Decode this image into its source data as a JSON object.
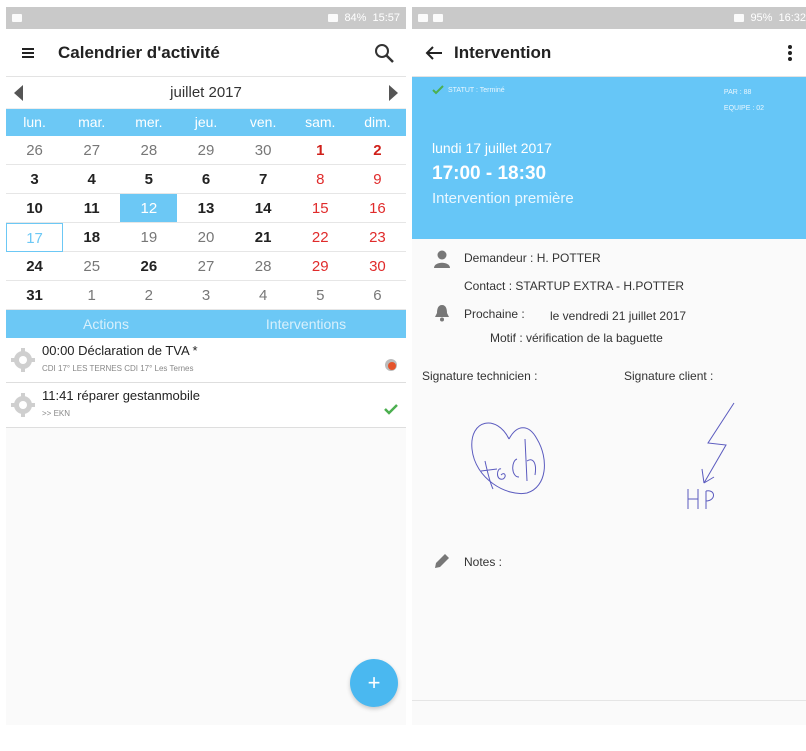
{
  "left": {
    "status": {
      "battery": "84%",
      "time": "15:57"
    },
    "appbar": {
      "title": "Calendrier d'activité"
    },
    "calendar": {
      "month": "juillet 2017",
      "weekdays": [
        "lun.",
        "mar.",
        "mer.",
        "jeu.",
        "ven.",
        "sam.",
        "dim."
      ],
      "weeks": [
        [
          {
            "t": "26",
            "s": "dim"
          },
          {
            "t": "27",
            "s": "dim"
          },
          {
            "t": "28",
            "s": "dim"
          },
          {
            "t": "29",
            "s": "dim"
          },
          {
            "t": "30",
            "s": "dim"
          },
          {
            "t": "1",
            "s": "redbold"
          },
          {
            "t": "2",
            "s": "redbold"
          }
        ],
        [
          {
            "t": "3",
            "s": "bold"
          },
          {
            "t": "4",
            "s": "bold"
          },
          {
            "t": "5",
            "s": "bold"
          },
          {
            "t": "6",
            "s": "bold"
          },
          {
            "t": "7",
            "s": "bold"
          },
          {
            "t": "8",
            "s": "red"
          },
          {
            "t": "9",
            "s": "red"
          }
        ],
        [
          {
            "t": "10",
            "s": "bold"
          },
          {
            "t": "11",
            "s": "bold"
          },
          {
            "t": "12",
            "s": "selected"
          },
          {
            "t": "13",
            "s": "bold"
          },
          {
            "t": "14",
            "s": "bold"
          },
          {
            "t": "15",
            "s": "red"
          },
          {
            "t": "16",
            "s": "red"
          }
        ],
        [
          {
            "t": "17",
            "s": "today"
          },
          {
            "t": "18",
            "s": "bold"
          },
          {
            "t": "19",
            "s": "dim"
          },
          {
            "t": "20",
            "s": "dim"
          },
          {
            "t": "21",
            "s": "bold"
          },
          {
            "t": "22",
            "s": "red"
          },
          {
            "t": "23",
            "s": "red"
          }
        ],
        [
          {
            "t": "24",
            "s": "bold"
          },
          {
            "t": "25",
            "s": "dim"
          },
          {
            "t": "26",
            "s": "bold"
          },
          {
            "t": "27",
            "s": "dim"
          },
          {
            "t": "28",
            "s": "dim"
          },
          {
            "t": "29",
            "s": "red"
          },
          {
            "t": "30",
            "s": "red"
          }
        ],
        [
          {
            "t": "31",
            "s": "bold"
          },
          {
            "t": "1",
            "s": "dim"
          },
          {
            "t": "2",
            "s": "dim"
          },
          {
            "t": "3",
            "s": "dim"
          },
          {
            "t": "4",
            "s": "dim"
          },
          {
            "t": "5",
            "s": "dim"
          },
          {
            "t": "6",
            "s": "dim"
          }
        ]
      ]
    },
    "tabs": [
      "Actions",
      "Interventions"
    ],
    "items": [
      {
        "title": "00:00 Déclaration de TVA *",
        "subtitle": "CDI 17° LES TERNES CDI 17° Les Ternes",
        "status": "pending"
      },
      {
        "title": "11:41 réparer gestanmobile",
        "subtitle": ">> EKN",
        "status": "done"
      }
    ],
    "fab_label": "+"
  },
  "right": {
    "status": {
      "battery": "95%",
      "time": "16:32"
    },
    "appbar": {
      "title": "Intervention"
    },
    "hero": {
      "status_text": "STATUT : Terminé",
      "par": "PAR : 88",
      "equipe": "EQUIPE : 02",
      "date": "lundi 17 juillet 2017",
      "time": "17:00 - 18:30",
      "type": "Intervention première"
    },
    "demandeur": "Demandeur : H. POTTER",
    "contact": "Contact : STARTUP EXTRA - H.POTTER",
    "prochaine_label": "Prochaine :",
    "prochaine_value": "le vendredi 21 juillet 2017",
    "motif": "Motif : vérification de la baguette",
    "sig_tech_label": "Signature technicien :",
    "sig_client_label": "Signature client :",
    "notes_label": "Notes :"
  },
  "colors": {
    "accent": "#6cc8f5",
    "weekend": "#e02b2b",
    "check": "#4caf50"
  }
}
